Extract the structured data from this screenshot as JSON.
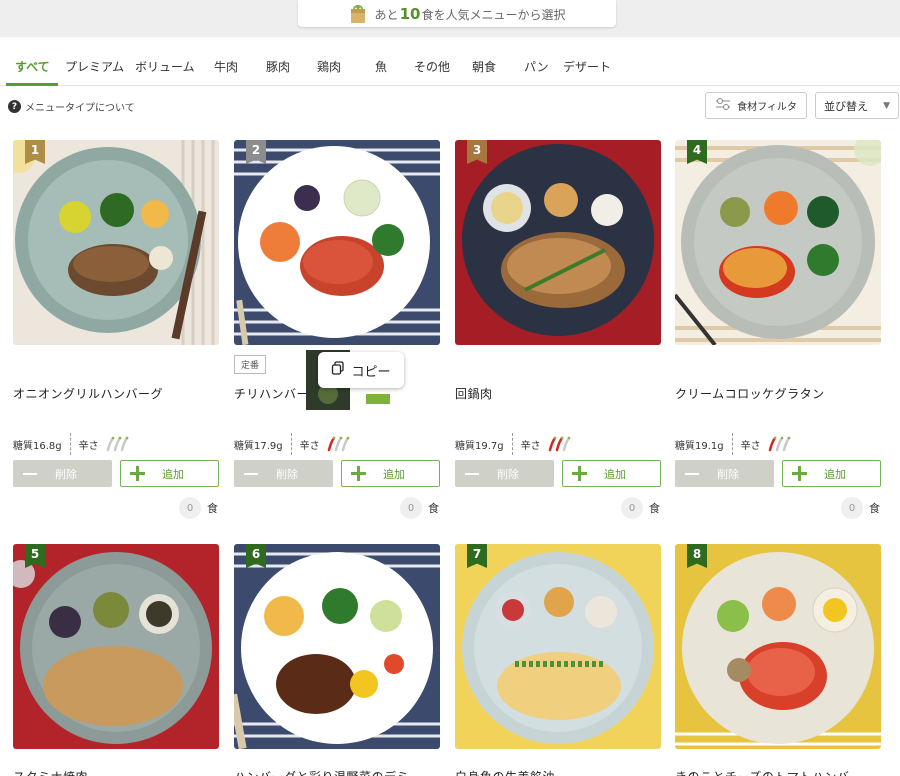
{
  "banner": {
    "prefix": "あと",
    "number": "10",
    "suffix": "食を人気メニューから選択"
  },
  "tabs": [
    {
      "label": "すべて",
      "active": true
    },
    {
      "label": "プレミアム"
    },
    {
      "label": "ボリューム"
    },
    {
      "label": "牛肉"
    },
    {
      "label": "豚肉"
    },
    {
      "label": "鶏肉"
    },
    {
      "label": "魚"
    },
    {
      "label": "その他"
    },
    {
      "label": "朝食"
    },
    {
      "label": "パン"
    },
    {
      "label": "デザート"
    }
  ],
  "info": {
    "icon": "question-icon",
    "label": "メニュータイプについて"
  },
  "filter": {
    "label": "食材フィルタ",
    "icon": "filter-icon"
  },
  "sort": {
    "label": "並び替え",
    "arrow": "▼"
  },
  "popup": {
    "label": "コピー",
    "icon": "copy-icon"
  },
  "labels": {
    "delete": "削除",
    "add": "追加",
    "unit": "食",
    "spicy": "辛さ"
  },
  "colors": {
    "accent": "#5a9a2f",
    "rank_gold": "#b08d47",
    "rank_silver": "#8d8d8d",
    "rank_bronze": "#a8773f",
    "rank_green": "#2f6b1f"
  },
  "cards": [
    {
      "rank": "1",
      "name": "オニオングリルハンバーグ",
      "carbs": "糖質16.8g",
      "spicy": 0,
      "count": "0",
      "tag": ""
    },
    {
      "rank": "2",
      "name": "チリハンバーグ",
      "carbs": "糖質17.9g",
      "spicy": 1,
      "count": "0",
      "tag": "定番"
    },
    {
      "rank": "3",
      "name": "回鍋肉",
      "carbs": "糖質19.7g",
      "spicy": 2,
      "count": "0",
      "tag": ""
    },
    {
      "rank": "4",
      "name": "クリームコロッケグラタン",
      "carbs": "糖質19.1g",
      "spicy": 1,
      "count": "0",
      "tag": ""
    },
    {
      "rank": "5",
      "name": "スタミナ焼肉",
      "carbs": "",
      "spicy": 0,
      "count": "",
      "tag": ""
    },
    {
      "rank": "6",
      "name": "ハンバーグと彩り温野菜のデミ",
      "carbs": "",
      "spicy": 0,
      "count": "",
      "tag": ""
    },
    {
      "rank": "7",
      "name": "白身魚の生姜餡油",
      "carbs": "",
      "spicy": 0,
      "count": "",
      "tag": ""
    },
    {
      "rank": "8",
      "name": "きのことチーズのトマトハンバ",
      "carbs": "",
      "spicy": 0,
      "count": "",
      "tag": ""
    }
  ]
}
